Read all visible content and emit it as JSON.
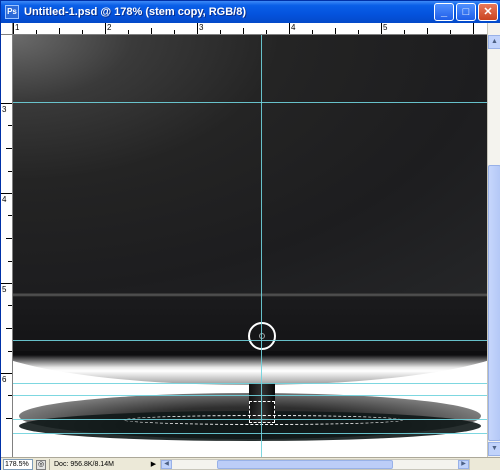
{
  "window": {
    "title": "Untitled-1.psd @ 178% (stem copy, RGB/8)",
    "app_icon_label": "Ps",
    "minimize_label": "_",
    "maximize_label": "□",
    "close_label": "✕"
  },
  "rulers": {
    "top_numbers": [
      "1",
      "2",
      "3",
      "4",
      "5"
    ],
    "left_numbers": [
      "3",
      "4",
      "5",
      "6"
    ]
  },
  "canvas": {
    "layer_name": "stem copy",
    "guide_color": "#6fd3dd"
  },
  "statusbar": {
    "zoom": "178.5%",
    "doc_info": "Doc: 956.8K/8.14M",
    "menu_arrow": "▶",
    "left_arrow": "◀",
    "right_arrow": "▶"
  },
  "colors": {
    "titlebar": "#0a5fe8",
    "close_button": "#c94421",
    "guides": "#6fd3dd"
  }
}
